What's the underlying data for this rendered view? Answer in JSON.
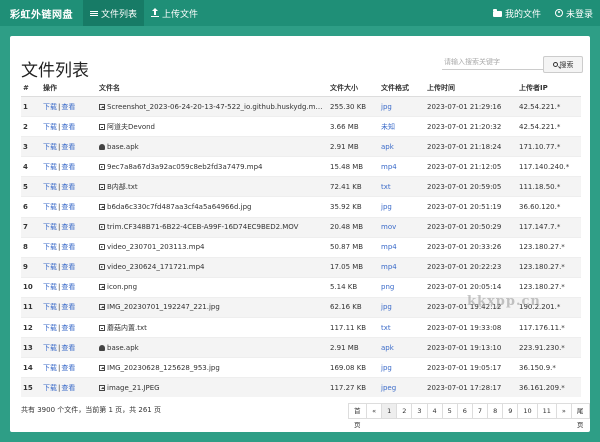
{
  "header": {
    "brand": "彩虹外链网盘",
    "nav": [
      {
        "label": "文件列表",
        "icon": "list-icon",
        "active": true
      },
      {
        "label": "上传文件",
        "icon": "upload-icon",
        "active": false
      }
    ],
    "right": [
      {
        "label": "我的文件",
        "icon": "folder-icon"
      },
      {
        "label": "未登录",
        "icon": "user-icon"
      }
    ]
  },
  "main": {
    "title": "文件列表",
    "search": {
      "placeholder": "请输入搜索关键字",
      "button_label": "搜索"
    },
    "table": {
      "columns": [
        "#",
        "操作",
        "文件名",
        "文件大小",
        "文件格式",
        "上传时间",
        "上传者IP"
      ],
      "action_download": "下载",
      "action_sep": "|",
      "action_view": "查看",
      "rows": [
        {
          "n": "1",
          "icon": "image",
          "name": "Screenshot_2023-06-24-20-13-47-522_io.github.huskydg.magis...",
          "size": "255.30 KB",
          "fmt": "jpg",
          "time": "2023-07-01 21:29:16",
          "ip": "42.54.221.*"
        },
        {
          "n": "2",
          "icon": "doc",
          "name": "阿道夫Devond",
          "size": "3.66 MB",
          "fmt": "未知",
          "time": "2023-07-01 21:20:32",
          "ip": "42.54.221.*"
        },
        {
          "n": "3",
          "icon": "android",
          "name": "base.apk",
          "size": "2.91 MB",
          "fmt": "apk",
          "time": "2023-07-01 21:18:24",
          "ip": "171.10.77.*"
        },
        {
          "n": "4",
          "icon": "video",
          "name": "9ec7a8a67d3a92ac059c8eb2fd3a7479.mp4",
          "size": "15.48 MB",
          "fmt": "mp4",
          "time": "2023-07-01 21:12:05",
          "ip": "117.140.240.*"
        },
        {
          "n": "5",
          "icon": "doc",
          "name": "B内部.txt",
          "size": "72.41 KB",
          "fmt": "txt",
          "time": "2023-07-01 20:59:05",
          "ip": "111.18.50.*"
        },
        {
          "n": "6",
          "icon": "image",
          "name": "b6da6c330c7fd487aa3cf4a5a64966d.jpg",
          "size": "35.92 KB",
          "fmt": "jpg",
          "time": "2023-07-01 20:51:19",
          "ip": "36.60.120.*"
        },
        {
          "n": "7",
          "icon": "video",
          "name": "trim.CF348B71-6B22-4CEB-A99F-16D74EC9BED2.MOV",
          "size": "20.48 MB",
          "fmt": "mov",
          "time": "2023-07-01 20:50:29",
          "ip": "117.147.7.*"
        },
        {
          "n": "8",
          "icon": "video",
          "name": "video_230701_203113.mp4",
          "size": "50.87 MB",
          "fmt": "mp4",
          "time": "2023-07-01 20:33:26",
          "ip": "123.180.27.*"
        },
        {
          "n": "9",
          "icon": "video",
          "name": "video_230624_171721.mp4",
          "size": "17.05 MB",
          "fmt": "mp4",
          "time": "2023-07-01 20:22:23",
          "ip": "123.180.27.*"
        },
        {
          "n": "10",
          "icon": "image",
          "name": "icon.png",
          "size": "5.14 KB",
          "fmt": "png",
          "time": "2023-07-01 20:05:14",
          "ip": "123.180.27.*"
        },
        {
          "n": "11",
          "icon": "image",
          "name": "IMG_20230701_192247_221.jpg",
          "size": "62.16 KB",
          "fmt": "jpg",
          "time": "2023-07-01 19:42:12",
          "ip": "190.2.201.*"
        },
        {
          "n": "12",
          "icon": "doc",
          "name": "蘑菇内置.txt",
          "size": "117.11 KB",
          "fmt": "txt",
          "time": "2023-07-01 19:33:08",
          "ip": "117.176.11.*"
        },
        {
          "n": "13",
          "icon": "android",
          "name": "base.apk",
          "size": "2.91 MB",
          "fmt": "apk",
          "time": "2023-07-01 19:13:10",
          "ip": "223.91.230.*"
        },
        {
          "n": "14",
          "icon": "image",
          "name": "IMG_20230628_125628_953.jpg",
          "size": "169.08 KB",
          "fmt": "jpg",
          "time": "2023-07-01 19:05:17",
          "ip": "36.150.9.*"
        },
        {
          "n": "15",
          "icon": "image",
          "name": "image_21.JPEG",
          "size": "117.27 KB",
          "fmt": "jpeg",
          "time": "2023-07-01 17:28:17",
          "ip": "36.161.209.*"
        }
      ]
    },
    "footer": "共有 3900 个文件，当前第 1 页，共 261 页",
    "pagination": [
      "首页",
      "«",
      "1",
      "2",
      "3",
      "4",
      "5",
      "6",
      "7",
      "8",
      "9",
      "10",
      "11",
      "»",
      "尾页"
    ],
    "watermark": "kkxpp.cn"
  },
  "colors": {
    "header_bg": "#1f8f77",
    "page_bg": "#2e9e86",
    "link": "#3b6bc9"
  }
}
